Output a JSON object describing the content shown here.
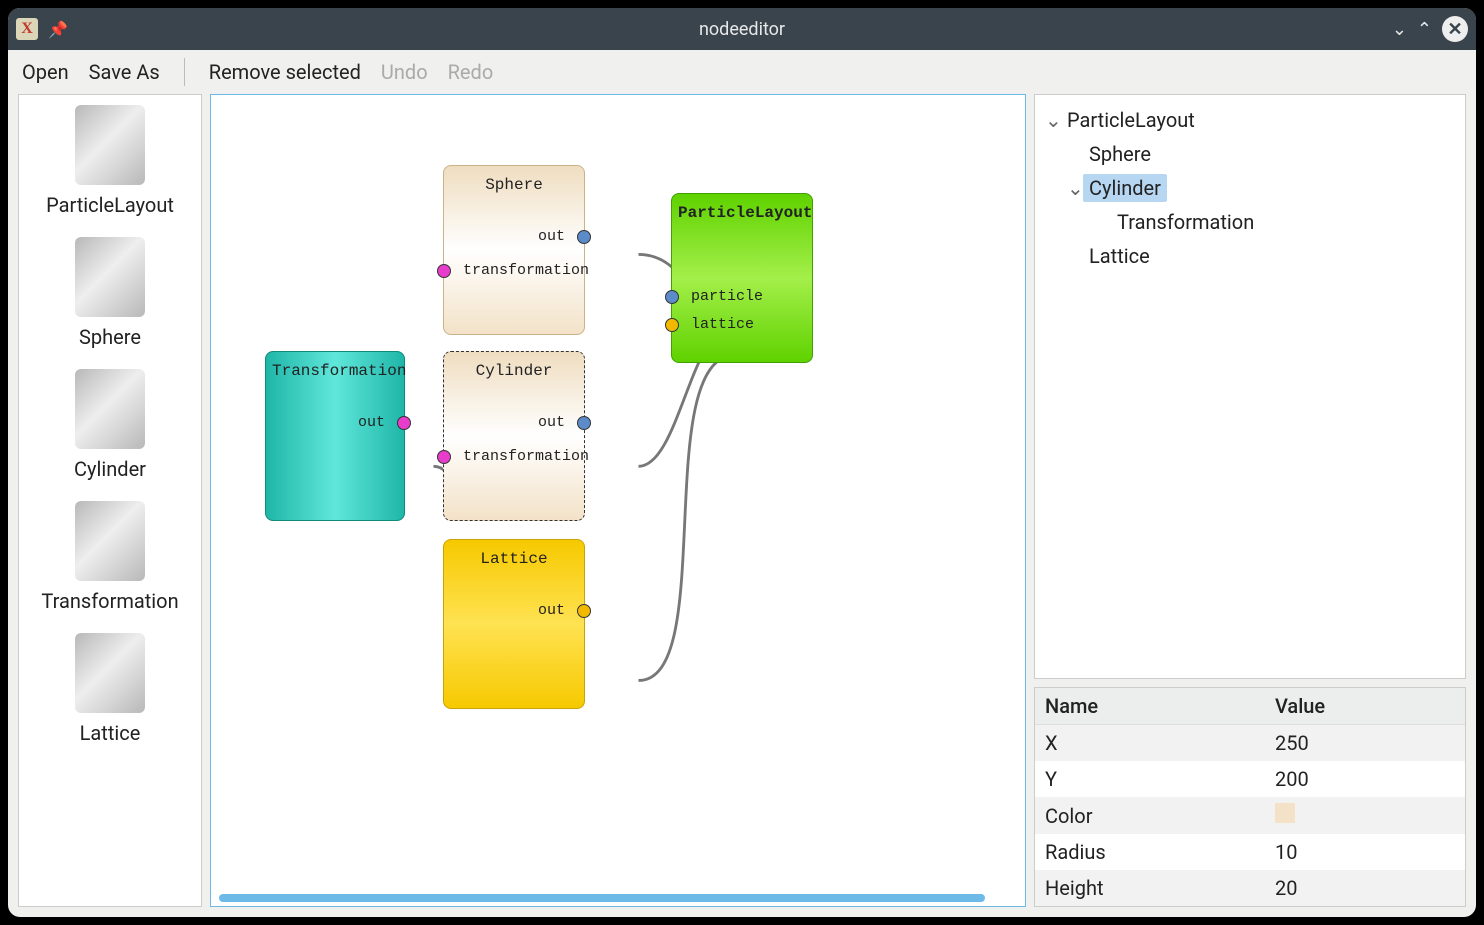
{
  "window": {
    "title": "nodeeditor"
  },
  "toolbar": {
    "open": "Open",
    "saveas": "Save As",
    "remove": "Remove selected",
    "undo": "Undo",
    "redo": "Redo"
  },
  "palette": {
    "items": [
      "ParticleLayout",
      "Sphere",
      "Cylinder",
      "Transformation",
      "Lattice"
    ]
  },
  "nodes": {
    "sphere": {
      "title": "Sphere",
      "ports": {
        "out": "out",
        "transformation": "transformation"
      }
    },
    "cylinder": {
      "title": "Cylinder",
      "ports": {
        "out": "out",
        "transformation": "transformation"
      }
    },
    "transform": {
      "title": "Transformation",
      "ports": {
        "out": "out"
      }
    },
    "lattice": {
      "title": "Lattice",
      "ports": {
        "out": "out"
      }
    },
    "playout": {
      "title": "ParticleLayout",
      "ports": {
        "particle": "particle",
        "lattice": "lattice"
      }
    }
  },
  "tree": {
    "root": "ParticleLayout",
    "items": [
      {
        "label": "Sphere",
        "depth": 1,
        "selected": false,
        "expandable": false
      },
      {
        "label": "Cylinder",
        "depth": 1,
        "selected": true,
        "expandable": true
      },
      {
        "label": "Transformation",
        "depth": 2,
        "selected": false,
        "expandable": false
      },
      {
        "label": "Lattice",
        "depth": 1,
        "selected": false,
        "expandable": false
      }
    ]
  },
  "props": {
    "headers": {
      "name": "Name",
      "value": "Value"
    },
    "rows": [
      {
        "name": "X",
        "value": "250"
      },
      {
        "name": "Y",
        "value": "200"
      },
      {
        "name": "Color",
        "value": "",
        "swatch": "#f3e2c8"
      },
      {
        "name": "Radius",
        "value": "10"
      },
      {
        "name": "Height",
        "value": "20"
      }
    ]
  }
}
